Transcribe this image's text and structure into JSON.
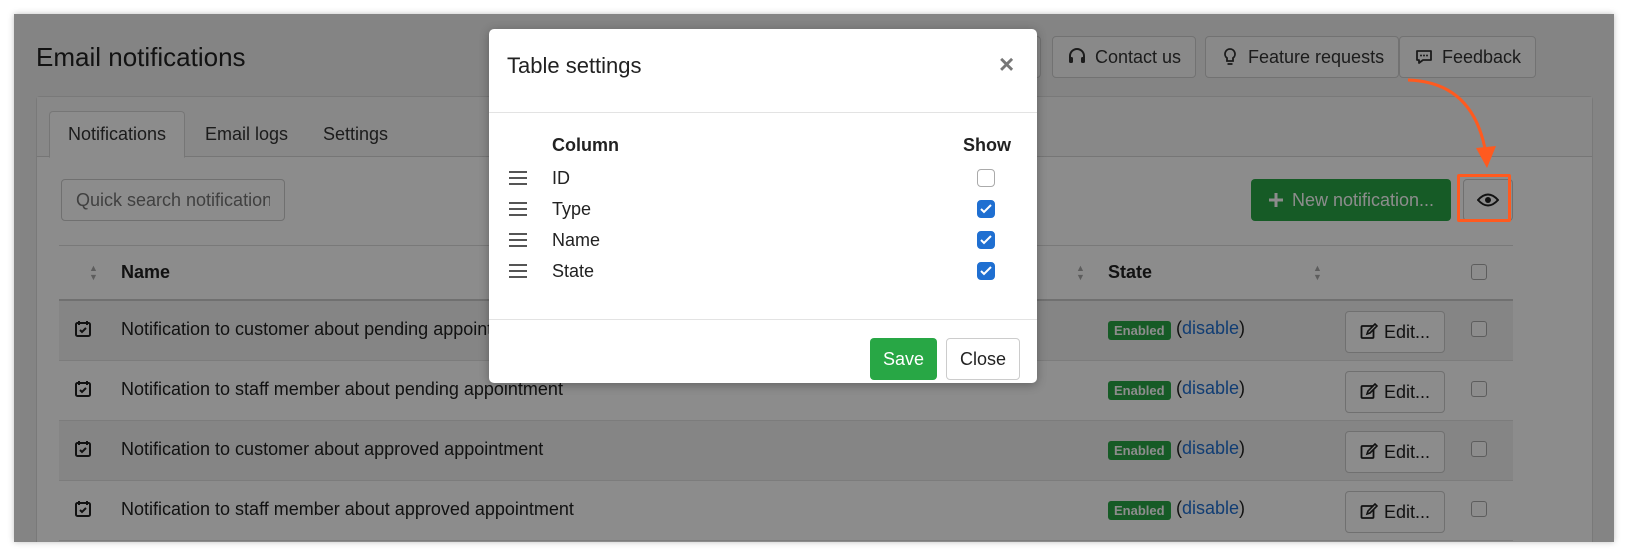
{
  "page": {
    "title": "Email notifications"
  },
  "top_buttons": {
    "contact": "Contact us",
    "features": "Feature requests",
    "feedback": "Feedback"
  },
  "tabs": [
    {
      "label": "Notifications"
    },
    {
      "label": "Email logs"
    },
    {
      "label": "Settings"
    }
  ],
  "toolbar": {
    "search_placeholder": "Quick search notifications",
    "new_button": "New notification..."
  },
  "table": {
    "headers": {
      "name": "Name",
      "state": "State"
    },
    "rows": [
      {
        "name": "Notification to customer about pending appointment",
        "badge": "Enabled",
        "action": "disable",
        "edit": "Edit..."
      },
      {
        "name": "Notification to staff member about pending appointment",
        "badge": "Enabled",
        "action": "disable",
        "edit": "Edit..."
      },
      {
        "name": "Notification to customer about approved appointment",
        "badge": "Enabled",
        "action": "disable",
        "edit": "Edit..."
      },
      {
        "name": "Notification to staff member about approved appointment",
        "badge": "Enabled",
        "action": "disable",
        "edit": "Edit..."
      }
    ]
  },
  "modal": {
    "title": "Table settings",
    "close_icon": "×",
    "column_header": "Column",
    "show_header": "Show",
    "columns": [
      {
        "label": "ID",
        "checked": false
      },
      {
        "label": "Type",
        "checked": true
      },
      {
        "label": "Name",
        "checked": true
      },
      {
        "label": "State",
        "checked": true
      }
    ],
    "save": "Save",
    "close": "Close"
  },
  "colors": {
    "accent_green": "#28a745",
    "link_blue": "#1f6fd1",
    "highlight_orange": "#ff5a1f"
  }
}
